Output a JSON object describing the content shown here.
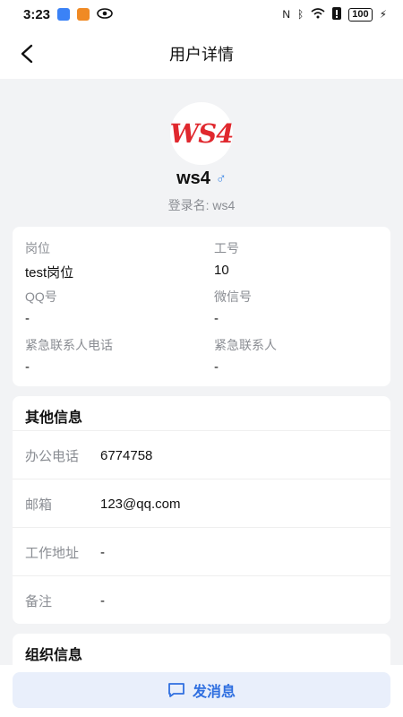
{
  "status_bar": {
    "time": "3:23",
    "battery": "100"
  },
  "header": {
    "title": "用户详情"
  },
  "profile": {
    "avatar_text": "WS4",
    "name": "ws4",
    "gender_symbol": "♂",
    "login_name": "登录名: ws4"
  },
  "info_grid": [
    {
      "label": "岗位",
      "value": "test岗位"
    },
    {
      "label": "工号",
      "value": "10"
    },
    {
      "label": "QQ号",
      "value": "-"
    },
    {
      "label": "微信号",
      "value": "-"
    },
    {
      "label": "紧急联系人电话",
      "value": "-"
    },
    {
      "label": "紧急联系人",
      "value": "-"
    }
  ],
  "other_info": {
    "title": "其他信息",
    "rows": [
      {
        "label": "办公电话",
        "value": "6774758"
      },
      {
        "label": "邮箱",
        "value": "123@qq.com"
      },
      {
        "label": "工作地址",
        "value": "-"
      },
      {
        "label": "备注",
        "value": "-"
      }
    ]
  },
  "org_info": {
    "title": "组织信息"
  },
  "actions": {
    "send_message": "发消息"
  },
  "colors": {
    "accent": "#2f6fe0",
    "button_bg": "#e9effb",
    "avatar_red": "#e0282e",
    "gender_blue": "#3a86e6"
  }
}
